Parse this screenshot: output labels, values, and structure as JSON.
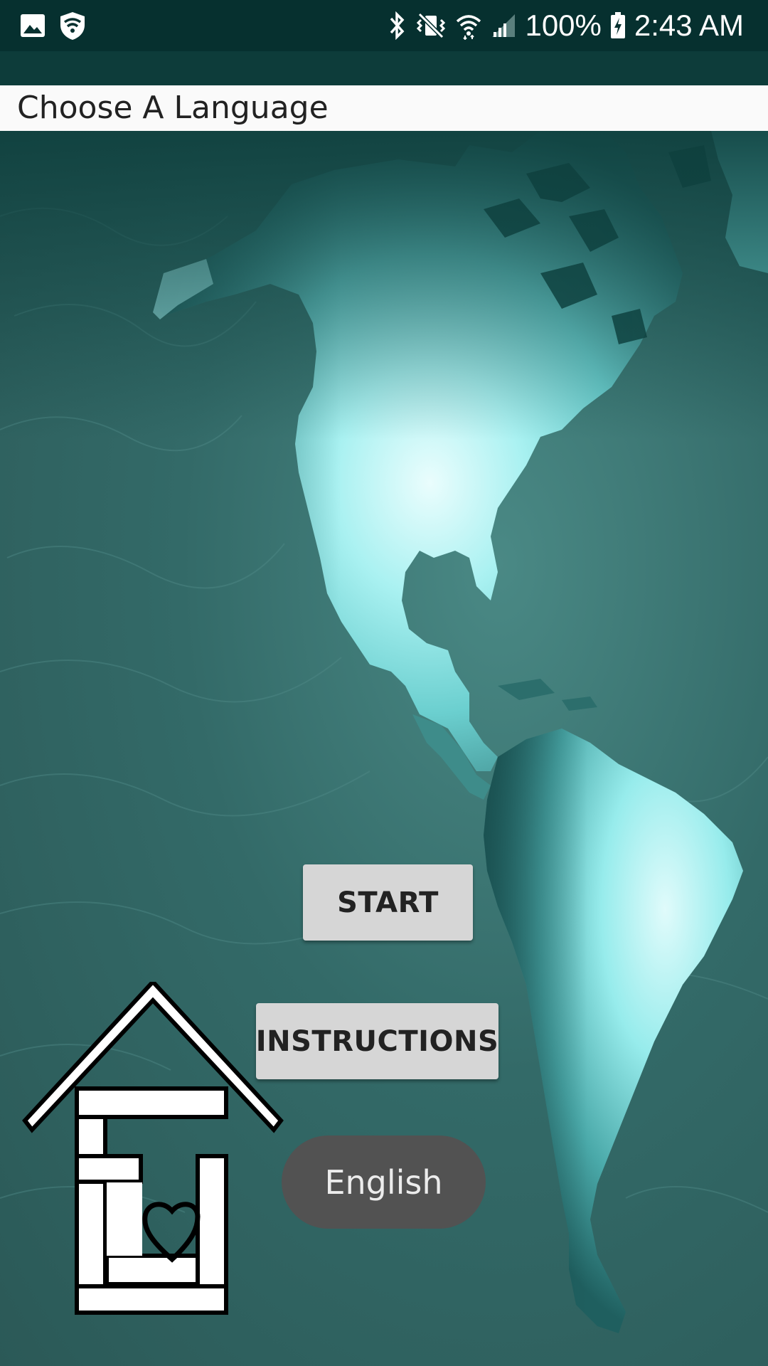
{
  "status_bar": {
    "battery": "100%",
    "time": "2:43 AM",
    "left_icons": [
      "gallery-icon",
      "shield-wifi-icon"
    ],
    "right_icons": [
      "bluetooth-icon",
      "vibrate-mute-icon",
      "wifi-icon",
      "signal-icon",
      "battery-charging-icon"
    ]
  },
  "title_bar": {
    "title": "Choose A Language"
  },
  "main": {
    "start_label": "START",
    "instructions_label": "INSTRUCTIONS",
    "language_label": "English"
  },
  "colors": {
    "status_bar_bg": "#06302f",
    "map_bg": "#2f5f5d",
    "continent_highlight": "#7eecee",
    "button_bg": "#d6d6d6",
    "language_button_bg": "#525252"
  }
}
